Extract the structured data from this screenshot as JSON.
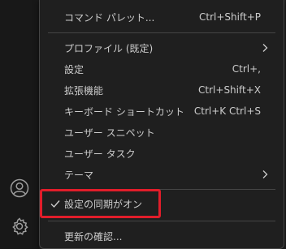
{
  "activity_bar": {
    "icons": [
      "account-icon",
      "gear-icon"
    ]
  },
  "menu": {
    "command_palette": {
      "label": "コマンド パレット...",
      "shortcut": "Ctrl+Shift+P"
    },
    "profile": {
      "label": "プロファイル (既定)"
    },
    "settings": {
      "label": "設定",
      "shortcut": "Ctrl+,"
    },
    "extensions": {
      "label": "拡張機能",
      "shortcut": "Ctrl+Shift+X"
    },
    "keyboard_shortcuts": {
      "label": "キーボード ショートカット",
      "shortcut": "Ctrl+K Ctrl+S"
    },
    "user_snippets": {
      "label": "ユーザー スニペット"
    },
    "user_tasks": {
      "label": "ユーザー タスク"
    },
    "theme": {
      "label": "テーマ"
    },
    "settings_sync": {
      "label": "設定の同期がオン",
      "checked": true
    },
    "check_updates": {
      "label": "更新の確認..."
    }
  },
  "colors": {
    "highlight": "#e11d2a",
    "menu_bg": "#1f1f1f",
    "text": "#cccccc"
  }
}
